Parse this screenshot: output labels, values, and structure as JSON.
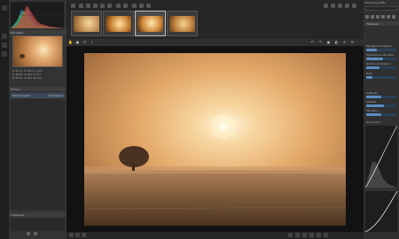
{
  "left": {
    "navigator_title": "Navigator",
    "history_title": "History",
    "history_item_left": "Photo loaded",
    "history_item_right": "Last Saved",
    "snapshots_title": "Snapshots",
    "info": {
      "rows": [
        [
          "R: 43.1%",
          "H: 18.3",
          "L: 41.8"
        ],
        [
          "G: 38.6%",
          "S: 56.2",
          "A: 5.7"
        ],
        [
          "B: 28.4%",
          "V: 43.1",
          "B: 17.2"
        ]
      ]
    }
  },
  "right": {
    "tab_title": "Processing Profile",
    "header": "Exposure",
    "sliders": [
      {
        "label": "Highlight compression",
        "value": 0.35
      },
      {
        "label": "Highlight reconstruction",
        "value": 0.55
      },
      {
        "label": "Shadow compression",
        "value": 0.45
      },
      {
        "label": "Black",
        "value": 0.2
      },
      {
        "label": "Lightness",
        "value": 0.5
      },
      {
        "label": "Contrast",
        "value": 0.6
      },
      {
        "label": "Saturation",
        "value": 0.5
      }
    ],
    "tone_curve_label": "Tone curve 1"
  },
  "colors": {
    "accent": "#5b8cc2",
    "panel": "#333333",
    "viewer_bg": "#121212"
  }
}
